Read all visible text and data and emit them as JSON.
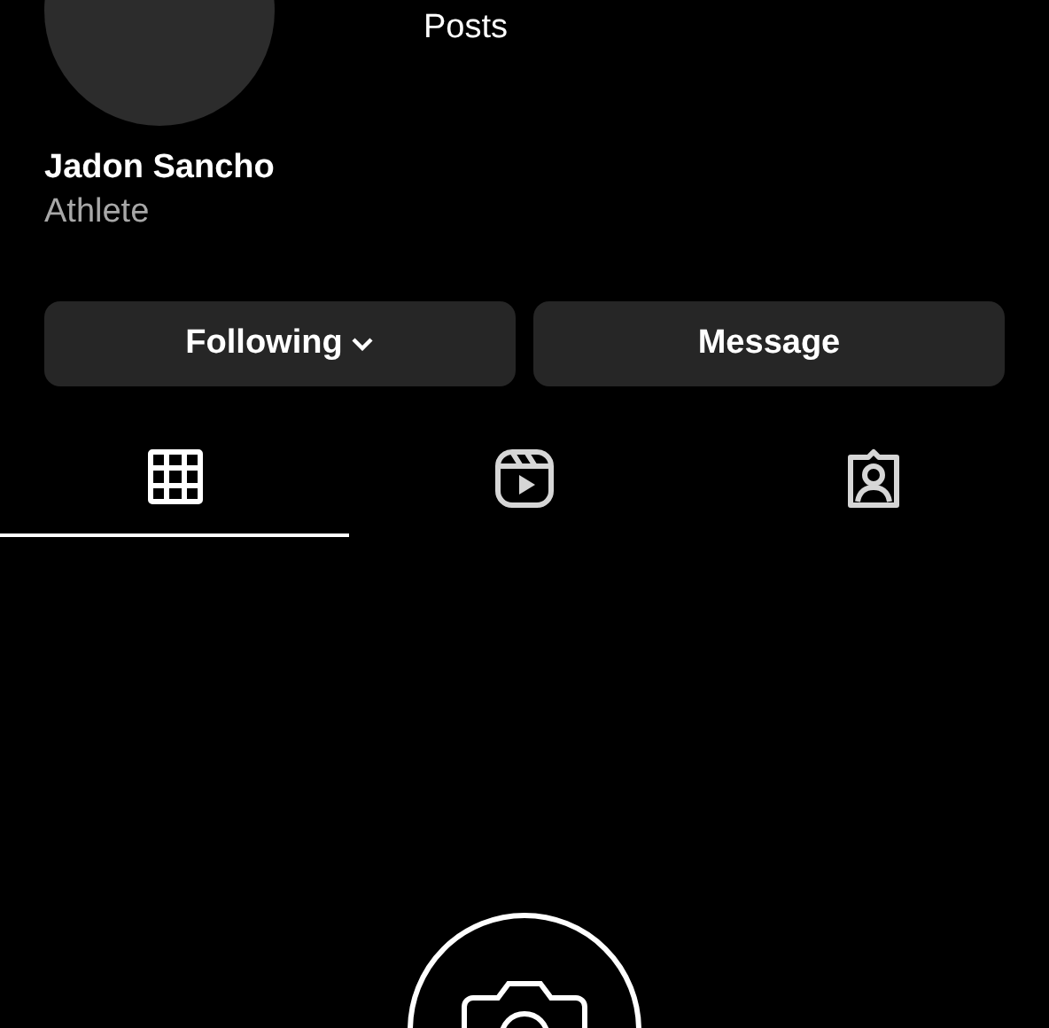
{
  "profile": {
    "name": "Jadon Sancho",
    "category": "Athlete"
  },
  "stats": [
    {
      "label": "Posts"
    }
  ],
  "buttons": [
    {
      "label": "Following",
      "kind": "dropdown"
    },
    {
      "label": "Message",
      "kind": "plain"
    }
  ],
  "tabs": [
    {
      "kind": "grid",
      "selected": true
    },
    {
      "kind": "reels",
      "selected": false
    },
    {
      "kind": "tagged",
      "selected": false
    }
  ]
}
